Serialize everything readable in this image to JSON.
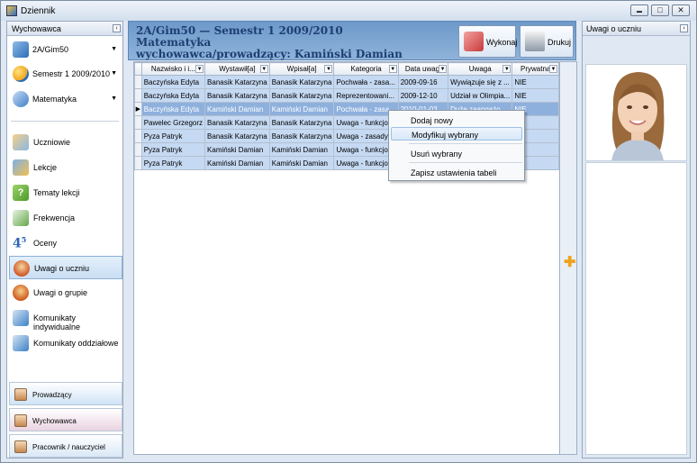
{
  "window": {
    "title": "Dziennik"
  },
  "sidebar": {
    "header": "Wychowawca",
    "collapse_glyph": "‹",
    "selectors": [
      {
        "label": "2A/Gim50",
        "icon": "class-icon"
      },
      {
        "label": "Semestr 1 2009/2010",
        "icon": "semester-icon"
      },
      {
        "label": "Matematyka",
        "icon": "subject-icon"
      }
    ],
    "items": [
      {
        "label": "Uczniowie",
        "icon": "students-icon"
      },
      {
        "label": "Lekcje",
        "icon": "lessons-icon"
      },
      {
        "label": "Tematy lekcji",
        "icon": "topics-icon"
      },
      {
        "label": "Frekwencja",
        "icon": "attendance-icon"
      },
      {
        "label": "Oceny",
        "icon": "grades-icon"
      },
      {
        "label": "Uwagi o uczniu",
        "icon": "student-notes-icon",
        "active": true
      },
      {
        "label": "Uwagi o grupie",
        "icon": "group-notes-icon"
      },
      {
        "label": "Komunikaty indywidualne",
        "icon": "individual-messages-icon"
      },
      {
        "label": "Komunikaty oddziałowe",
        "icon": "class-messages-icon"
      }
    ],
    "roles": [
      {
        "label": "Prowadzący",
        "color": "#cfe3f6"
      },
      {
        "label": "Wychowawca",
        "color": "#ead3e2"
      },
      {
        "label": "Pracownik / nauczyciel",
        "color": "#d9e8f6"
      }
    ]
  },
  "header": {
    "line1": "2A/Gim50 — Semestr 1 2009/2010",
    "line2": "Matematyka",
    "line3": "wychowawca/prowadzący: Kamiński Damian",
    "execute_label": "Wykonaj",
    "print_label": "Drukuj"
  },
  "table": {
    "columns": [
      "Nazwisko i i...",
      "Wystawił[a]",
      "Wpisał[a]",
      "Kategoria",
      "Data uwagi",
      "Uwaga",
      "Prywatna"
    ],
    "rows": [
      [
        "Baczyńska Edyta",
        "Banasik Katarzyna",
        "Banasik Katarzyna",
        "Pochwała - zasa...",
        "2009-09-16",
        "Wywiązuje się z ...",
        "NIE"
      ],
      [
        "Baczyńska Edyta",
        "Banasik Katarzyna",
        "Banasik Katarzyna",
        "Reprezentowani...",
        "2009-12-10",
        "Udział w Olimpia...",
        "NIE"
      ],
      [
        "Baczyńska Edyta",
        "Kamiński Damian",
        "Kamiński Damian",
        "Pochwała - zasa...",
        "2010-01-03",
        "Duże zaangażo...",
        "NIE"
      ],
      [
        "Pawelec Grzegorz",
        "Banasik Katarzyna",
        "Banasik Katarzyna",
        "Uwaga - funkcjo...",
        "20",
        "",
        ""
      ],
      [
        "Pyza Patryk",
        "Banasik Katarzyna",
        "Banasik Katarzyna",
        "Uwaga - zasady ...",
        "20",
        "",
        ""
      ],
      [
        "Pyza Patryk",
        "Kamiński Damian",
        "Kamiński Damian",
        "Uwaga - funkcjo...",
        "20",
        "",
        ""
      ],
      [
        "Pyza Patryk",
        "Kamiński Damian",
        "Kamiński Damian",
        "Uwaga - funkcjo...",
        "20",
        "",
        ""
      ]
    ],
    "selected_row": 2,
    "row_indicator": "▶",
    "add_glyph": "✚"
  },
  "context_menu": {
    "items": [
      "Dodaj nowy",
      "Modyfikuj wybrany",
      "Usuń wybrany",
      "Zapisz ustawienia tabeli"
    ],
    "hovered": 1
  },
  "right_panel": {
    "title": "Uwagi o uczniu",
    "expand_glyph": "›"
  },
  "title_buttons": {
    "minimize": "▬",
    "maximize": "□",
    "close": "✕"
  },
  "colors": {
    "header_bg": "#7fa6d2",
    "row_bg": "#c5d9f2",
    "row_selected_bg": "#8eb0dd",
    "accent_plus": "#f0a21c"
  }
}
